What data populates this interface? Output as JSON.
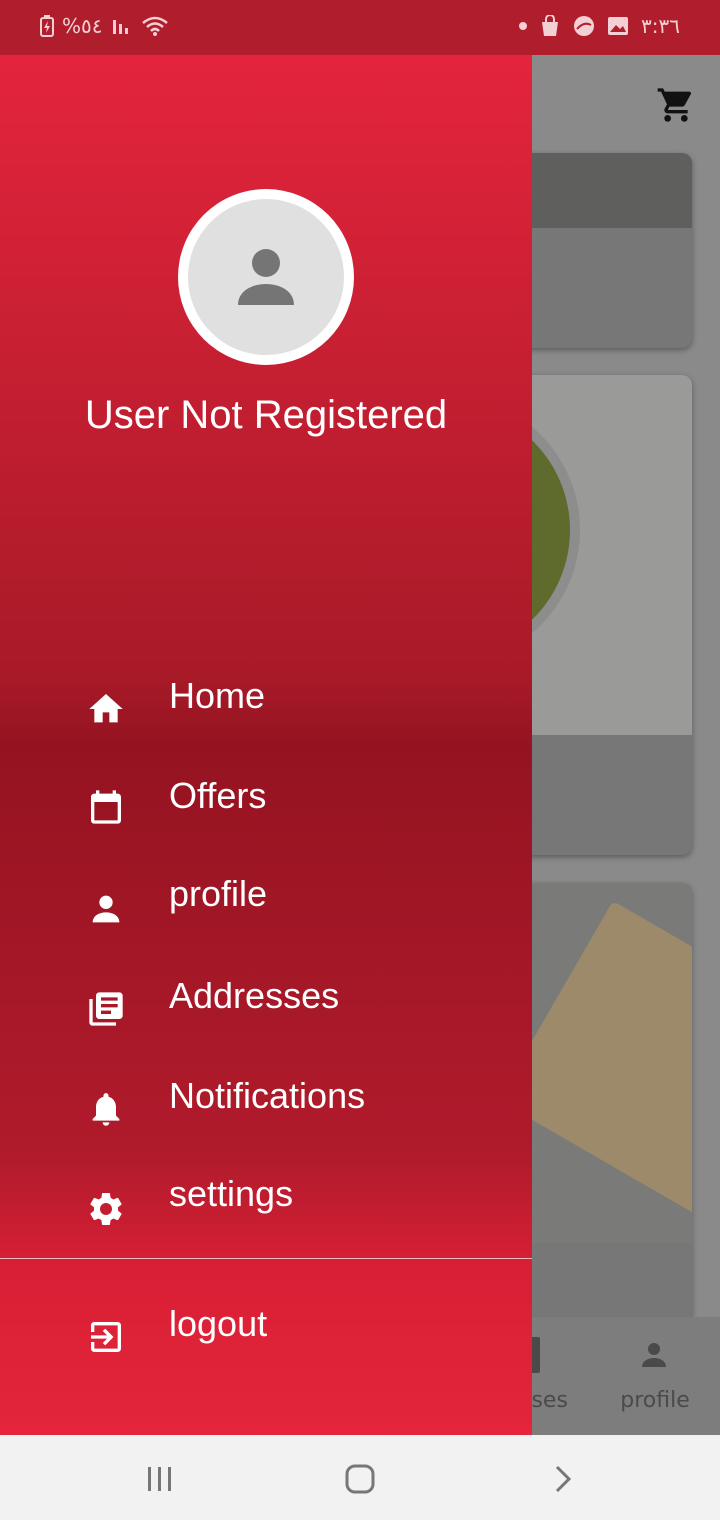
{
  "status_bar": {
    "battery": "%٥٤",
    "time": "٣:٣٦"
  },
  "drawer": {
    "user_name": "User Not Registered",
    "menu": [
      {
        "label": "Home",
        "icon": "home-icon"
      },
      {
        "label": "Offers",
        "icon": "calendar-icon"
      },
      {
        "label": "profile",
        "icon": "person-icon"
      },
      {
        "label": "Addresses",
        "icon": "library-icon"
      },
      {
        "label": "Notifications",
        "icon": "bell-icon"
      },
      {
        "label": "settings",
        "icon": "gear-icon"
      }
    ],
    "logout": {
      "label": "logout",
      "icon": "logout-icon"
    }
  },
  "background_app": {
    "bottom_nav": {
      "addresses_partial": "sses",
      "profile": "profile"
    }
  },
  "colors": {
    "drawer_top": "#e4243c",
    "drawer_mid": "#951321",
    "status_bar": "#b01e2e"
  }
}
